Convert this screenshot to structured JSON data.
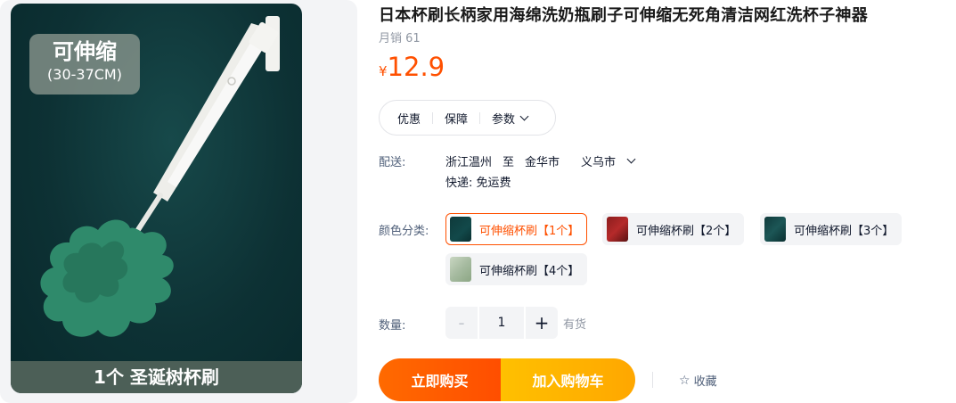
{
  "gallery": {
    "badge_line1": "可伸缩",
    "badge_line2": "(30-37CM)",
    "caption": "1个  圣诞树杯刷"
  },
  "product": {
    "title": "日本杯刷长柄家用海绵洗奶瓶刷子可伸缩无死角清洁网红洗杯子神器",
    "sales": "月销 61",
    "currency": "¥",
    "price": "12.9",
    "price_color": "#ff5000"
  },
  "tabs": [
    "优惠",
    "保障",
    "参数"
  ],
  "shipping": {
    "label": "配送:",
    "from": "浙江温州",
    "to_word": "至",
    "city": "金华市",
    "district": "义乌市",
    "express": "快递: 免运费"
  },
  "sku": {
    "label": "颜色分类:",
    "options": [
      "可伸缩杯刷【1个】",
      "可伸缩杯刷【2个】",
      "可伸缩杯刷【3个】",
      "可伸缩杯刷【4个】"
    ],
    "selected": "可伸缩杯刷【1个】"
  },
  "quantity": {
    "label": "数量:",
    "minus": "-",
    "value": "1",
    "plus": "+",
    "stock": "有货"
  },
  "actions": {
    "buy_now": "立即购买",
    "add_cart": "加入购物车",
    "favorite": "收藏",
    "star_glyph": "☆"
  }
}
